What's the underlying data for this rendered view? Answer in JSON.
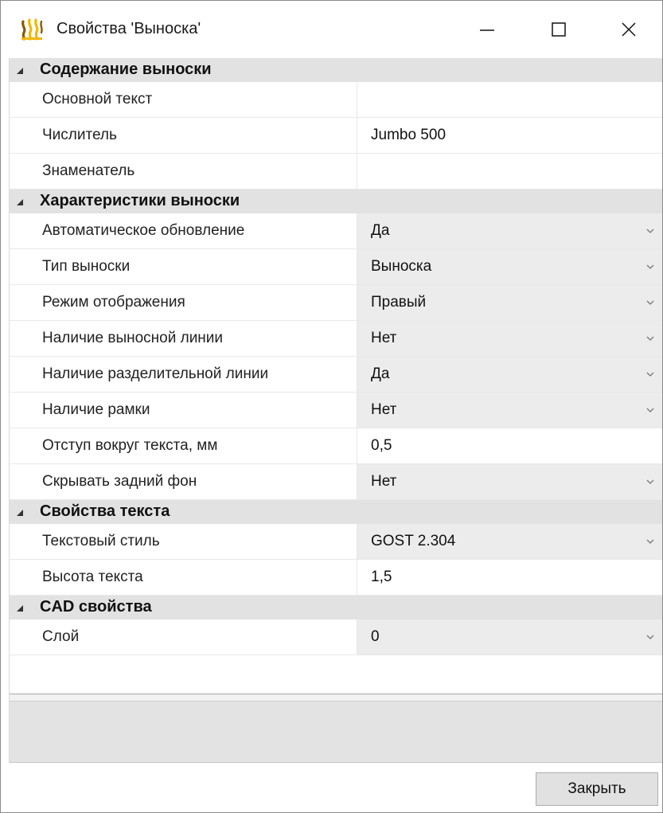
{
  "window": {
    "title": "Свойства 'Выноска'",
    "icon": "app-logo-icon"
  },
  "grid": {
    "categories": [
      {
        "label": "Содержание выноски",
        "rows": [
          {
            "name": "Основной текст",
            "value": "",
            "combo": false
          },
          {
            "name": "Числитель",
            "value": "Jumbo 500",
            "combo": false
          },
          {
            "name": "Знаменатель",
            "value": "",
            "combo": false
          }
        ]
      },
      {
        "label": "Характеристики выноски",
        "rows": [
          {
            "name": "Автоматическое обновление",
            "value": "Да",
            "combo": true
          },
          {
            "name": "Тип выноски",
            "value": "Выноска",
            "combo": true
          },
          {
            "name": "Режим отображения",
            "value": "Правый",
            "combo": true
          },
          {
            "name": "Наличие выносной линии",
            "value": "Нет",
            "combo": true
          },
          {
            "name": "Наличие разделительной линии",
            "value": "Да",
            "combo": true
          },
          {
            "name": "Наличие рамки",
            "value": "Нет",
            "combo": true
          },
          {
            "name": "Отступ вокруг текста, мм",
            "value": "0,5",
            "combo": false
          },
          {
            "name": "Скрывать задний фон",
            "value": "Нет",
            "combo": true
          }
        ]
      },
      {
        "label": "Свойства текста",
        "rows": [
          {
            "name": "Текстовый стиль",
            "value": "GOST 2.304",
            "combo": true
          },
          {
            "name": "Высота текста",
            "value": "1,5",
            "combo": false
          }
        ]
      },
      {
        "label": "CAD свойства",
        "rows": [
          {
            "name": "Слой",
            "value": "0",
            "combo": true
          }
        ]
      }
    ]
  },
  "footer": {
    "close_label": "Закрыть"
  },
  "colors": {
    "category_bg": "#e2e2e2",
    "combo_bg": "#ececec",
    "icon_yellow": "#f2b705",
    "icon_dark": "#8a5a00"
  }
}
